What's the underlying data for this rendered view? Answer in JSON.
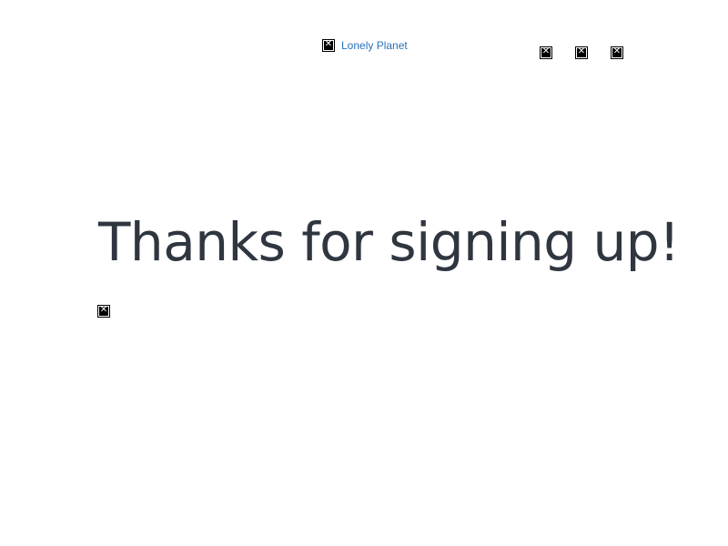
{
  "header": {
    "logo_alt": "Lonely Planet",
    "icons": [
      "broken-image-icon",
      "broken-image-icon",
      "broken-image-icon"
    ]
  },
  "main": {
    "headline": "Thanks for signing up!"
  }
}
